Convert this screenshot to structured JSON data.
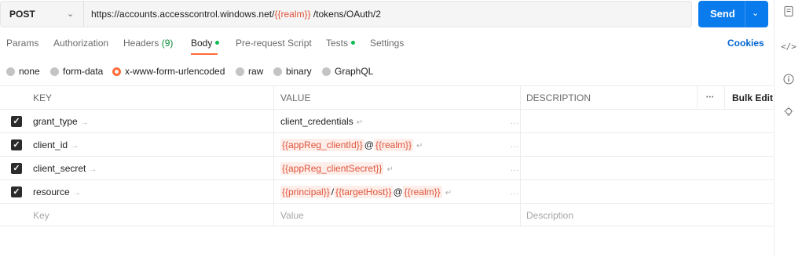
{
  "request": {
    "method": "POST",
    "url_parts": [
      {
        "text": "https://accounts.accesscontrol.windows.net/",
        "var": false
      },
      {
        "text": "{{realm}}",
        "var": true
      },
      {
        "text": " /tokens/OAuth/2",
        "var": false
      }
    ],
    "send_label": "Send"
  },
  "tabs": [
    {
      "label": "Params"
    },
    {
      "label": "Authorization"
    },
    {
      "label": "Headers",
      "count": "(9)"
    },
    {
      "label": "Body",
      "dot": true,
      "active": true
    },
    {
      "label": "Pre-request Script"
    },
    {
      "label": "Tests",
      "dot": true
    },
    {
      "label": "Settings"
    }
  ],
  "cookies_label": "Cookies",
  "body_modes": [
    {
      "label": "none",
      "selected": false
    },
    {
      "label": "form-data",
      "selected": false
    },
    {
      "label": "x-www-form-urlencoded",
      "selected": true
    },
    {
      "label": "raw",
      "selected": false
    },
    {
      "label": "binary",
      "selected": false
    },
    {
      "label": "GraphQL",
      "selected": false
    }
  ],
  "table": {
    "headers": {
      "key": "KEY",
      "value": "VALUE",
      "description": "DESCRIPTION",
      "more": "ooo",
      "bulk_edit": "Bulk Edit"
    },
    "rows": [
      {
        "key": "grant_type",
        "value_parts": [
          {
            "text": "client_credentials",
            "var": false
          }
        ]
      },
      {
        "key": "client_id",
        "value_parts": [
          {
            "text": "{{appReg_clientId}}",
            "var": true
          },
          {
            "text": "@",
            "var": false
          },
          {
            "text": "{{realm}}",
            "var": true
          }
        ]
      },
      {
        "key": "client_secret",
        "value_parts": [
          {
            "text": "{{appReg_clientSecret}}",
            "var": true
          }
        ]
      },
      {
        "key": "resource",
        "value_parts": [
          {
            "text": "{{principal}}",
            "var": true
          },
          {
            "text": "/",
            "var": false
          },
          {
            "text": "{{targetHost}}",
            "var": true
          },
          {
            "text": "@",
            "var": false
          },
          {
            "text": "{{realm}}",
            "var": true
          }
        ]
      }
    ],
    "placeholders": {
      "key": "Key",
      "value": "Value",
      "description": "Description"
    }
  },
  "colors": {
    "accent": "#ff6c37",
    "send": "#097bed",
    "variable": "#e0533b",
    "link": "#0265d2",
    "status_dot": "#0cbb52"
  }
}
